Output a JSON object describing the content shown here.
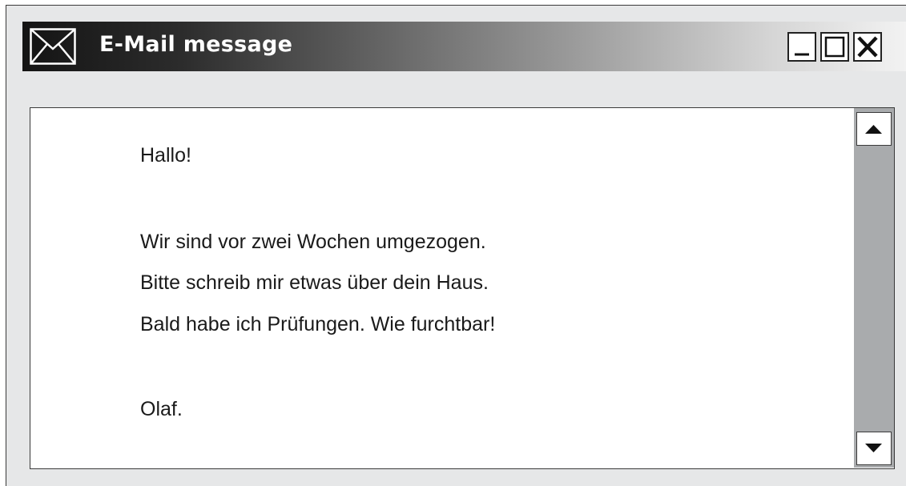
{
  "window": {
    "title": "E-Mail message",
    "title_icon": "envelope-icon",
    "controls": {
      "minimize_icon": "minimize-icon",
      "maximize_icon": "maximize-icon",
      "close_icon": "close-icon"
    }
  },
  "message": {
    "greeting": "Hallo!",
    "lines": [
      "Wir sind vor zwei Wochen umgezogen.",
      "Bitte schreib mir etwas über dein Haus.",
      "Bald habe ich Prüfungen.  Wie furchtbar!"
    ],
    "signature": "Olaf."
  },
  "scrollbar": {
    "up_icon": "scroll-up-arrow-icon",
    "down_icon": "scroll-down-arrow-icon"
  },
  "colors": {
    "window_background": "#e6e7e8",
    "titlebar_dark": "#141414",
    "titlebar_light": "#f2f2f2",
    "scrollbar_track": "#a9abad",
    "text": "#1a1a1a"
  }
}
